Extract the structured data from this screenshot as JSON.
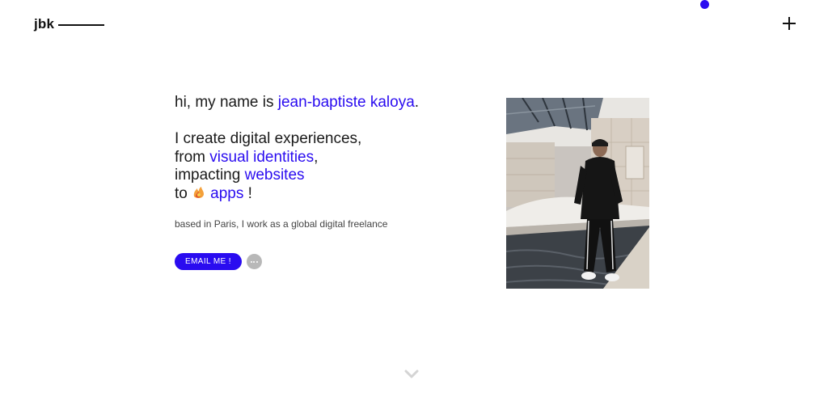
{
  "header": {
    "logo_text": "jbk",
    "menu_icon": "plus-icon"
  },
  "intro": {
    "greeting_prefix": "hi, my name is ",
    "name": "jean-baptiste kaloya",
    "greeting_suffix": ".",
    "line1": "I create digital experiences,",
    "line2_prefix": "from ",
    "line2_link": "visual identities",
    "line2_suffix": ",",
    "line3_prefix": "impacting ",
    "line3_link": "websites",
    "line4_prefix": "to ",
    "line4_icon": "flame-emoji-icon",
    "line4_link": "apps",
    "line4_suffix": " !",
    "tagline": "based in Paris, I work as a global digital freelance"
  },
  "cta": {
    "email_label": "EMAIL ME !",
    "more_icon": "more-dots-icon"
  },
  "scroll": {
    "icon": "chevron-down-icon"
  },
  "colors": {
    "accent": "#2a0cf0",
    "text": "#1a1a1a",
    "muted": "#444444",
    "more_button": "#b8b8b8"
  }
}
